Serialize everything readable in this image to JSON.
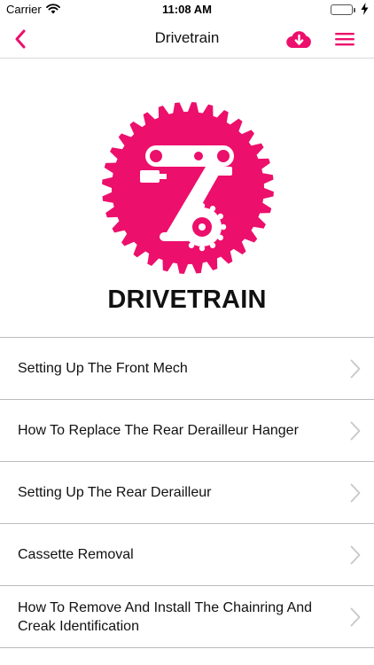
{
  "status_bar": {
    "carrier": "Carrier",
    "time": "11:08 AM"
  },
  "nav": {
    "title": "Drivetrain"
  },
  "hero": {
    "heading": "DRIVETRAIN"
  },
  "topics": [
    {
      "label": "Setting Up The Front Mech"
    },
    {
      "label": "How To Replace The Rear Derailleur Hanger"
    },
    {
      "label": "Setting Up The Rear Derailleur"
    },
    {
      "label": "Cassette Removal"
    },
    {
      "label": "How To Remove And Install The Chainring And Creak Identification"
    }
  ],
  "icons": {
    "back": "chevron-left-icon",
    "download": "cloud-download-icon",
    "menu": "hamburger-menu-icon",
    "row": "chevron-right-icon",
    "emblem": "rear-derailleur-icon"
  },
  "colors": {
    "accent": "#ec0f6b",
    "text": "#111111",
    "divider": "#bcbcbc",
    "chevron": "#c7c7cc"
  }
}
